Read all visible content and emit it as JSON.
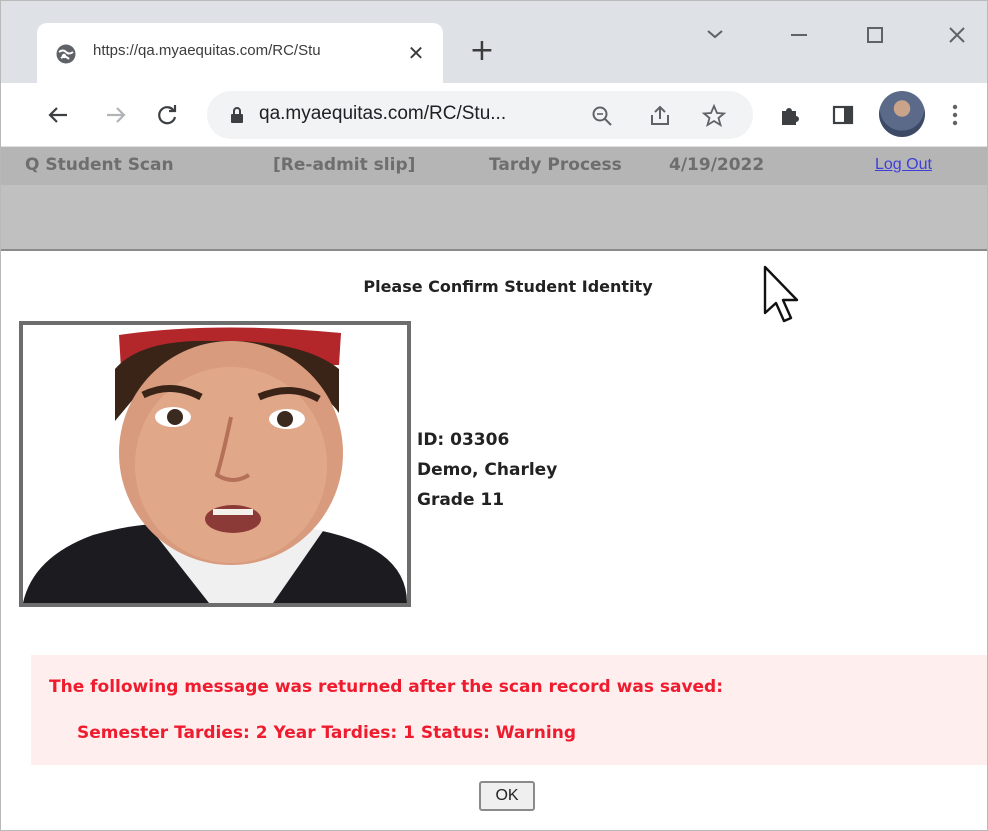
{
  "browser": {
    "tab": {
      "title": "https://qa.myaequitas.com/RC/Stu",
      "close_glyph": "✕",
      "favicon": "globe-icon"
    },
    "new_tab_glyph": "+",
    "window_controls": [
      "chevron-down-icon",
      "minimize-icon",
      "maximize-icon",
      "close-icon"
    ],
    "omnibox": {
      "url": "qa.myaequitas.com/RC/Stu...",
      "icons": [
        "lock-icon",
        "zoom-icon",
        "share-icon",
        "star-icon"
      ]
    },
    "toolbar_icons": [
      "back-icon",
      "forward-icon",
      "reload-icon",
      "extensions-icon",
      "side-panel-icon",
      "avatar",
      "kebab-menu-icon"
    ]
  },
  "app_header": {
    "title": "Q Student Scan",
    "slip": "[Re-admit slip]",
    "process": "Tardy Process",
    "date": "4/19/2022",
    "logout": "Log Out"
  },
  "content": {
    "confirm_title": "Please Confirm Student Identity",
    "student": {
      "id_line": "ID: 03306",
      "name": "Demo, Charley",
      "grade": "Grade 11"
    },
    "message": {
      "intro": "The following message was returned after the scan record was saved:",
      "details": "Semester Tardies: 2 Year Tardies: 1 Status: Warning"
    },
    "ok_label": "OK"
  },
  "colors": {
    "header_bg": "#b5b5b5",
    "header_text": "#6e6e6e",
    "link": "#3f3fd8",
    "message_bg": "#ffeeee",
    "message_text": "#ee1c2e"
  }
}
